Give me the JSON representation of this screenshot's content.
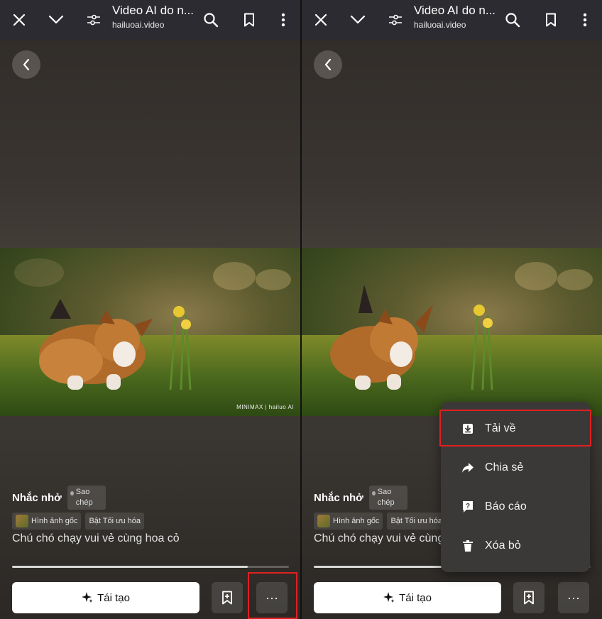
{
  "browser": {
    "page_title": "Video AI do n...",
    "url": "hailuoai.video",
    "icons": [
      "close-icon",
      "chevron-down-icon",
      "tune-icon",
      "search-icon",
      "bookmark-icon",
      "more-vert-icon"
    ]
  },
  "video": {
    "watermark": "MINIMAX | hailuo AI"
  },
  "prompt": {
    "title": "Nhắc nhở",
    "copy_label": "Sao chép",
    "tag_original": "Hình ảnh gốc",
    "tag_optimize": "Bật Tối ưu hóa",
    "text": "Chú chó chạy vui vẻ cùng hoa cỏ"
  },
  "progress": {
    "fraction": 0.85
  },
  "actions": {
    "regenerate_label": "Tái tạo",
    "more_label": "···"
  },
  "menu": {
    "items": [
      {
        "label": "Tải về",
        "icon": "download-icon"
      },
      {
        "label": "Chia sẻ",
        "icon": "share-icon"
      },
      {
        "label": "Báo cáo",
        "icon": "report-icon"
      },
      {
        "label": "Xóa bỏ",
        "icon": "trash-icon"
      }
    ]
  },
  "colors": {
    "highlight": "#e02020",
    "topbar": "#2c2b31",
    "menu_bg": "#3b3937"
  }
}
